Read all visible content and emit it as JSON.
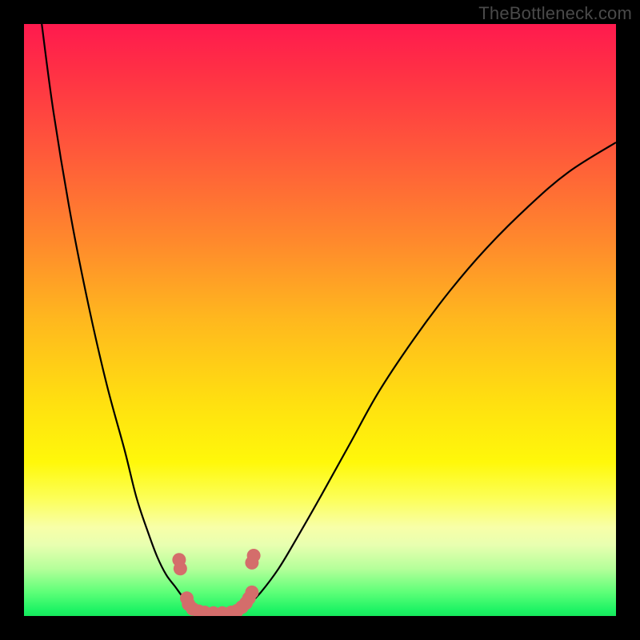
{
  "watermark": "TheBottleneck.com",
  "colors": {
    "frame": "#000000",
    "gradient_top": "#ff1a4e",
    "gradient_bottom": "#17e85c",
    "curve": "#000000",
    "marker": "#d46d6b"
  },
  "chart_data": {
    "type": "line",
    "title": "",
    "xlabel": "",
    "ylabel": "",
    "xlim": [
      0,
      100
    ],
    "ylim": [
      0,
      100
    ],
    "series": [
      {
        "name": "left-curve",
        "x": [
          3,
          5,
          8,
          11,
          14,
          17,
          19,
          21,
          22.5,
          24,
          25.5,
          27,
          28.5,
          30
        ],
        "y": [
          100,
          85,
          67,
          52,
          39,
          28,
          20,
          14,
          10,
          7,
          5,
          3,
          1.5,
          0.5
        ]
      },
      {
        "name": "right-curve",
        "x": [
          36,
          38,
          40,
          43,
          46,
          50,
          55,
          60,
          66,
          72,
          78,
          85,
          92,
          100
        ],
        "y": [
          0.5,
          2,
          4,
          8,
          13,
          20,
          29,
          38,
          47,
          55,
          62,
          69,
          75,
          80
        ]
      }
    ],
    "markers": {
      "name": "highlighted-points",
      "color": "#d46d6b",
      "points": [
        {
          "x": 26.2,
          "y": 9.5
        },
        {
          "x": 26.4,
          "y": 8.0
        },
        {
          "x": 27.5,
          "y": 3.0
        },
        {
          "x": 27.8,
          "y": 2.0
        },
        {
          "x": 28.5,
          "y": 1.2
        },
        {
          "x": 29.5,
          "y": 0.8
        },
        {
          "x": 30.5,
          "y": 0.6
        },
        {
          "x": 32.0,
          "y": 0.5
        },
        {
          "x": 33.5,
          "y": 0.5
        },
        {
          "x": 35.0,
          "y": 0.6
        },
        {
          "x": 36.0,
          "y": 0.9
        },
        {
          "x": 36.8,
          "y": 1.5
        },
        {
          "x": 37.5,
          "y": 2.2
        },
        {
          "x": 38.0,
          "y": 3.0
        },
        {
          "x": 38.5,
          "y": 4.0
        },
        {
          "x": 38.5,
          "y": 9.0
        },
        {
          "x": 38.8,
          "y": 10.2
        }
      ]
    }
  }
}
